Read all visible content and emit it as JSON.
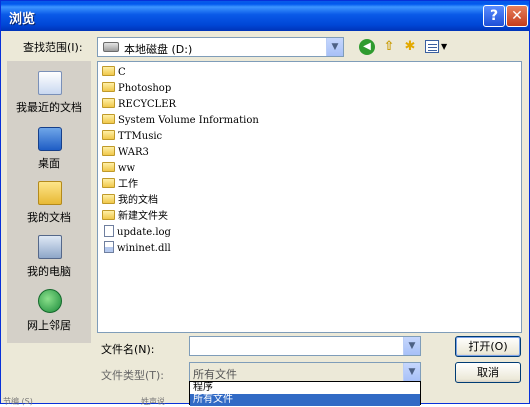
{
  "window": {
    "title": "浏览",
    "help_glyph": "?",
    "close_glyph": "✕"
  },
  "lookin": {
    "label": "查找范围(I):",
    "value": "本地磁盘 (D:)"
  },
  "places": [
    {
      "label": "我最近的文档",
      "icon": "recent-documents-icon"
    },
    {
      "label": "桌面",
      "icon": "desktop-icon"
    },
    {
      "label": "我的文档",
      "icon": "my-documents-icon"
    },
    {
      "label": "我的电脑",
      "icon": "my-computer-icon"
    },
    {
      "label": "网上邻居",
      "icon": "network-places-icon"
    }
  ],
  "files": [
    {
      "name": "C",
      "type": "folder"
    },
    {
      "name": "Photoshop",
      "type": "folder"
    },
    {
      "name": "RECYCLER",
      "type": "folder"
    },
    {
      "name": "System Volume Information",
      "type": "folder"
    },
    {
      "name": "TTMusic",
      "type": "folder"
    },
    {
      "name": "WAR3",
      "type": "folder"
    },
    {
      "name": "ww",
      "type": "folder"
    },
    {
      "name": "工作",
      "type": "folder"
    },
    {
      "name": "我的文档",
      "type": "folder"
    },
    {
      "name": "新建文件夹",
      "type": "folder"
    },
    {
      "name": "update.log",
      "type": "document"
    },
    {
      "name": "wininet.dll",
      "type": "dll"
    }
  ],
  "filename": {
    "label": "文件名(N):",
    "value": ""
  },
  "filetype": {
    "label": "文件类型(T):",
    "value": "所有文件",
    "options": [
      "程序",
      "所有文件"
    ]
  },
  "buttons": {
    "open": "打开(O)",
    "cancel": "取消"
  },
  "background": {
    "left_text": "节编 (S)",
    "mid_text": "姓声说"
  }
}
